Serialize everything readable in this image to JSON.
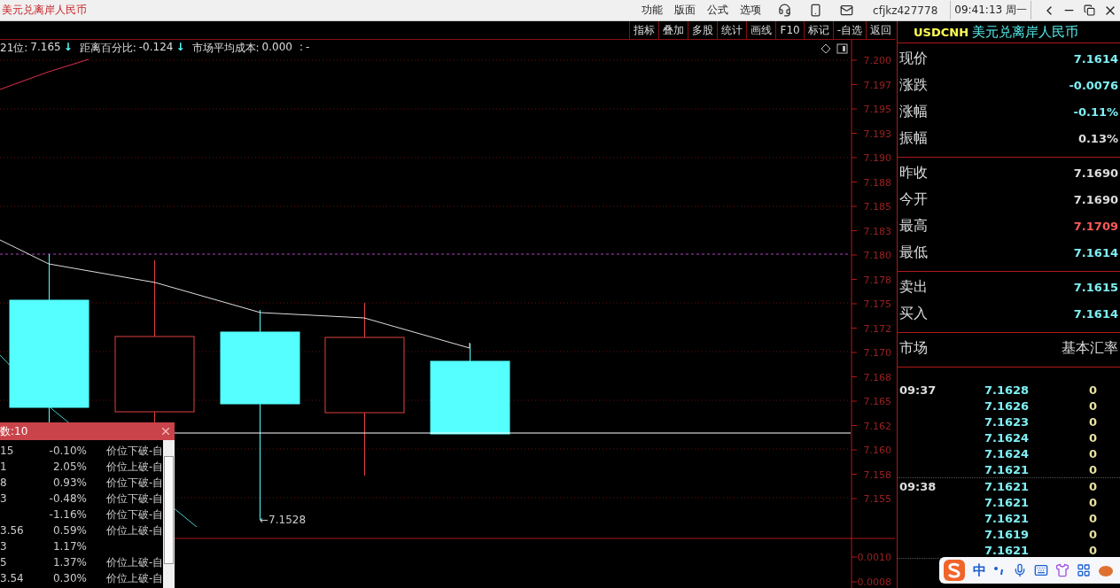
{
  "window": {
    "title": "美元兑离岸人民币",
    "menu": [
      "功能",
      "版面",
      "公式",
      "选项"
    ],
    "account": "cfjkz427778",
    "clock": "09:41:13 周一"
  },
  "toolbar": [
    "指标",
    "叠加",
    "多股",
    "统计",
    "画线",
    "F10",
    "标记",
    "-自选",
    "返回"
  ],
  "indicator_line": [
    {
      "label": "21位:",
      "value": "7.165",
      "arrow": "↓"
    },
    {
      "label": "距离百分比:",
      "value": "-0.124",
      "arrow": "↓"
    },
    {
      "label": "市场平均成本:",
      "value": "0.000"
    },
    {
      "label": ":",
      "value": "-"
    }
  ],
  "price_axis": [
    "7.200",
    "7.197",
    "7.195",
    "7.193",
    "7.190",
    "7.188",
    "7.185",
    "7.183",
    "7.180",
    "7.178",
    "7.175",
    "7.172",
    "7.170",
    "7.168",
    "7.165",
    "7.162",
    "7.160",
    "7.158",
    "7.155"
  ],
  "low_marker": "←7.1528",
  "sub_axis": [
    "0.0010",
    "0.0008"
  ],
  "alert_popup": {
    "title": "数:10",
    "rows": [
      {
        "column_1": "15",
        "change": "-0.10%",
        "signal": "价位下破-自"
      },
      {
        "column_1": "1",
        "change": "2.05%",
        "signal": "价位上破-自"
      },
      {
        "column_1": "8",
        "change": "0.93%",
        "signal": "价位下破-自"
      },
      {
        "column_1": "3",
        "change": "-0.48%",
        "signal": "价位下破-自"
      },
      {
        "change": "-1.16%",
        "signal": "价位下破-自"
      },
      {
        "column_1": "3.56",
        "change": "0.59%",
        "signal": "价位上破-自"
      },
      {
        "column_1": "3",
        "change": "1.17%"
      },
      {
        "column_1": "5",
        "change": "1.37%",
        "signal": "价位上破-自"
      },
      {
        "column_1": "3.54",
        "change": "0.30%",
        "signal": "价位上破-自"
      }
    ]
  },
  "quote": {
    "code": "USDCNH",
    "name": "美元兑离岸人民币",
    "groups": [
      [
        {
          "label": "现价",
          "value": "7.1614",
          "kind": "number",
          "color": "#7ff0f4"
        },
        {
          "label": "涨跌",
          "value": "-0.0076",
          "kind": "number",
          "color": "#7ff0f4"
        },
        {
          "label": "涨幅",
          "value": "-0.11%",
          "kind": "number",
          "color": "#7ff0f4"
        },
        {
          "label": "振幅",
          "value": "0.13%",
          "kind": "number",
          "color": "#dddddd"
        }
      ],
      [
        {
          "label": "昨收",
          "value": "7.1690",
          "kind": "number",
          "color": "#dddddd"
        },
        {
          "label": "今开",
          "value": "7.1690",
          "kind": "number",
          "color": "#dddddd"
        },
        {
          "label": "最高",
          "value": "7.1709",
          "kind": "number",
          "color": "#ff5a5a"
        },
        {
          "label": "最低",
          "value": "7.1614",
          "kind": "number",
          "color": "#7ff0f4"
        }
      ],
      [
        {
          "label": "卖出",
          "value": "7.1615",
          "kind": "number",
          "color": "#7ff0f4"
        },
        {
          "label": "买入",
          "value": "7.1614",
          "kind": "number",
          "color": "#7ff0f4"
        }
      ],
      [
        {
          "label": "市场",
          "value": "基本汇率",
          "kind": "text",
          "color": "#dddddd"
        }
      ]
    ]
  },
  "ticks": [
    {
      "time": "09:37",
      "rows": [
        {
          "price": "7.1628",
          "volume": "0"
        },
        {
          "price": "7.1626",
          "volume": "0"
        },
        {
          "price": "7.1623",
          "volume": "0"
        },
        {
          "price": "7.1624",
          "volume": "0"
        },
        {
          "price": "7.1624",
          "volume": "0"
        },
        {
          "price": "7.1621",
          "volume": "0"
        }
      ]
    },
    {
      "time": "09:38",
      "rows": [
        {
          "price": "7.1621",
          "volume": "0"
        },
        {
          "price": "7.1621",
          "volume": "0"
        },
        {
          "price": "7.1621",
          "volume": "0"
        },
        {
          "price": "7.1619",
          "volume": "0"
        },
        {
          "price": "7.1621",
          "volume": "0"
        }
      ]
    }
  ],
  "ime_bar": {
    "mode": "中"
  }
}
